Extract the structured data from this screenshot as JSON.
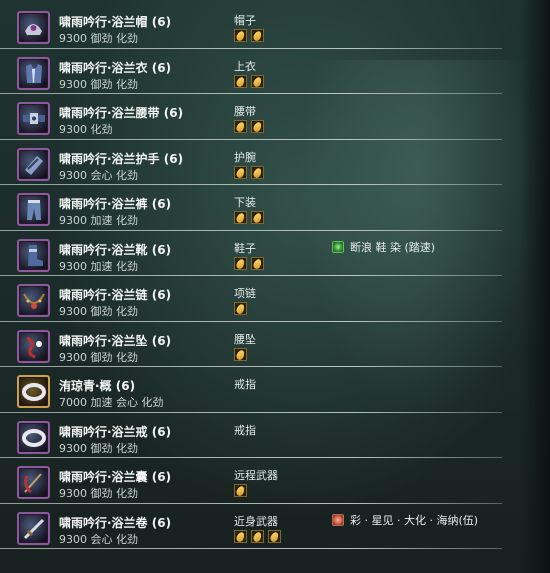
{
  "items": [
    {
      "name": "啸雨吟行·浴兰帽 (6)",
      "stats": "9300 御劲 化劲",
      "slot": "帽子",
      "gems": 2,
      "icon": "helmet-icon"
    },
    {
      "name": "啸雨吟行·浴兰衣 (6)",
      "stats": "9300 御劲 化劲",
      "slot": "上衣",
      "gems": 2,
      "icon": "chest-armor-icon"
    },
    {
      "name": "啸雨吟行·浴兰腰带 (6)",
      "stats": "9300 化劲",
      "slot": "腰带",
      "gems": 2,
      "icon": "belt-icon"
    },
    {
      "name": "啸雨吟行·浴兰护手 (6)",
      "stats": "9300 会心 化劲",
      "slot": "护腕",
      "gems": 2,
      "icon": "bracer-icon"
    },
    {
      "name": "啸雨吟行·浴兰裤 (6)",
      "stats": "9300 加速 化劲",
      "slot": "下装",
      "gems": 2,
      "icon": "pants-icon"
    },
    {
      "name": "啸雨吟行·浴兰靴 (6)",
      "stats": "9300 加速 化劲",
      "slot": "鞋子",
      "gems": 2,
      "icon": "boots-icon",
      "enhance": "断浪 鞋 染 (踏速)",
      "enhance_icon": "green"
    },
    {
      "name": "啸雨吟行·浴兰链 (6)",
      "stats": "9300 御劲 化劲",
      "slot": "项链",
      "gems": 1,
      "icon": "necklace-icon"
    },
    {
      "name": "啸雨吟行·浴兰坠 (6)",
      "stats": "9300 御劲 化劲",
      "slot": "腰坠",
      "gems": 1,
      "icon": "pendant-icon"
    },
    {
      "name": "洧琼青·概 (6)",
      "stats": "7000 加速 会心 化劲",
      "slot": "戒指",
      "gems": 0,
      "icon": "ring-icon",
      "gold": true
    },
    {
      "name": "啸雨吟行·浴兰戒 (6)",
      "stats": "9300 御劲 化劲",
      "slot": "戒指",
      "gems": 0,
      "icon": "ring-icon"
    },
    {
      "name": "啸雨吟行·浴兰囊 (6)",
      "stats": "9300 御劲 化劲",
      "slot": "远程武器",
      "gems": 1,
      "icon": "ranged-weapon-icon"
    },
    {
      "name": "啸雨吟行·浴兰卷 (6)",
      "stats": "9300 会心 化劲",
      "slot": "近身武器",
      "gems": 3,
      "icon": "melee-weapon-icon",
      "enhance": "彩 · 星见 · 大化 · 海纳(伍)",
      "enhance_icon": "red"
    }
  ],
  "colors": {
    "text": "#f2f5f3",
    "gem": "#f0b43a",
    "frame_epic": "#8a5a9a",
    "frame_gold": "#c9a24a"
  }
}
